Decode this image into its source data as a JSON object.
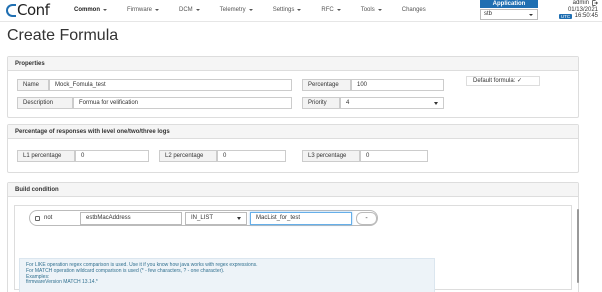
{
  "header": {
    "logo_text": "Conf",
    "nav": [
      {
        "label": "Common",
        "active": true
      },
      {
        "label": "Firmware",
        "active": false
      },
      {
        "label": "DCM",
        "active": false
      },
      {
        "label": "Telemetry",
        "active": false
      },
      {
        "label": "Settings",
        "active": false
      },
      {
        "label": "RFC",
        "active": false
      },
      {
        "label": "Tools",
        "active": false
      },
      {
        "label": "Changes",
        "active": false
      }
    ],
    "application": {
      "title": "Application",
      "value": "stb"
    },
    "user": {
      "name": "admin",
      "date": "01/13/2021",
      "utc_badge": "UTC",
      "time": "16:50:45"
    }
  },
  "page": {
    "title": "Create Formula"
  },
  "properties": {
    "heading": "Properties",
    "name": {
      "label": "Name",
      "value": "Mock_Fomula_test"
    },
    "description": {
      "label": "Description",
      "value": "Formua for velification"
    },
    "percentage": {
      "label": "Percentage",
      "value": "100"
    },
    "priority": {
      "label": "Priority",
      "value": "4"
    },
    "default_formula": {
      "label": "Default formula:",
      "mark": "✓"
    }
  },
  "percentage_section": {
    "heading": "Percentage of responses with level one/two/three logs",
    "l1": {
      "label": "L1 percentage",
      "value": "0"
    },
    "l2": {
      "label": "L2 percentage",
      "value": "0"
    },
    "l3": {
      "label": "L3 percentage",
      "value": "0"
    }
  },
  "build_condition": {
    "heading": "Build condition",
    "not_label": "not",
    "key": "estbMacAddress",
    "operation": "IN_LIST",
    "value": "MacList_for_test",
    "remove_label": "-",
    "help": [
      "For LIKE operation regex comparison is used. Use it if you know how java works with regex expressions.",
      "For MATCH operation wildcard comparison is used (* - few characters, ? - one character).",
      "Examples:",
      "firmwareVersion MATCH 13.14.*"
    ]
  },
  "colors": {
    "brand": "#1f6fb2",
    "panel_heading_bg": "#f5f5f5",
    "help_bg": "#edf3f8"
  }
}
